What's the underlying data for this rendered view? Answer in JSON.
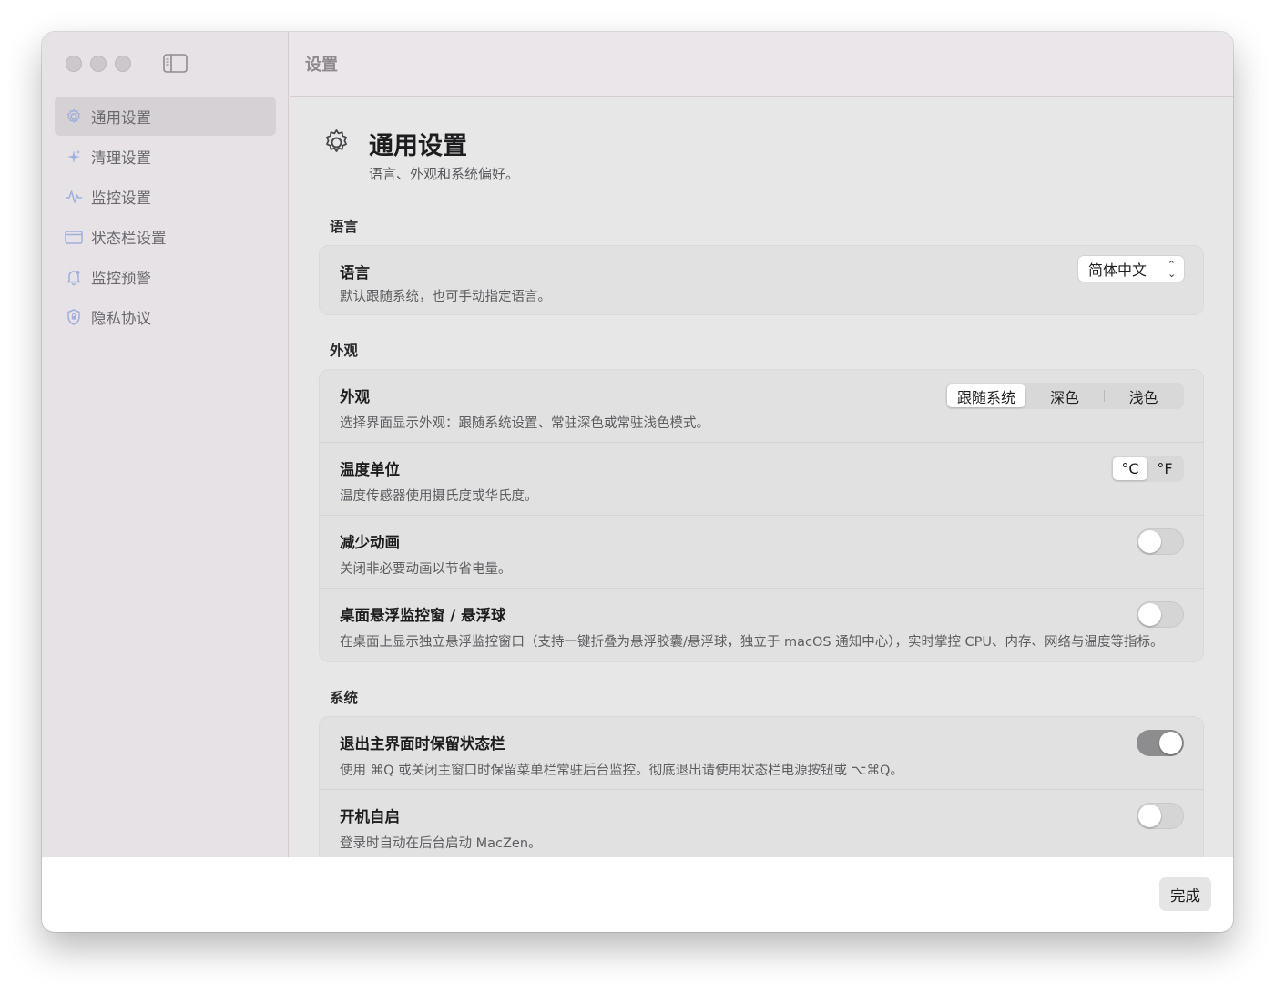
{
  "window": {
    "title": "设置"
  },
  "sidebar": {
    "items": [
      {
        "label": "通用设置",
        "icon": "gear-icon",
        "active": true
      },
      {
        "label": "清理设置",
        "icon": "sparkles-icon"
      },
      {
        "label": "监控设置",
        "icon": "waveform-icon"
      },
      {
        "label": "状态栏设置",
        "icon": "menubar-icon"
      },
      {
        "label": "监控预警",
        "icon": "bell-icon"
      },
      {
        "label": "隐私协议",
        "icon": "shield-icon"
      }
    ]
  },
  "page": {
    "title": "通用设置",
    "subtitle": "语言、外观和系统偏好。"
  },
  "sections": {
    "language": {
      "label": "语言",
      "rows": [
        {
          "title": "语言",
          "desc": "默认跟随系统，也可手动指定语言。",
          "value": "简体中文"
        }
      ]
    },
    "appearance": {
      "label": "外观",
      "rows": [
        {
          "title": "外观",
          "desc": "选择界面显示外观：跟随系统设置、常驻深色或常驻浅色模式。",
          "options": [
            "跟随系统",
            "深色",
            "浅色"
          ],
          "selected": "跟随系统"
        },
        {
          "title": "温度单位",
          "desc": "温度传感器使用摄氏度或华氏度。",
          "options": [
            "°C",
            "°F"
          ],
          "selected": "°C"
        },
        {
          "title": "减少动画",
          "desc": "关闭非必要动画以节省电量。",
          "on": false
        },
        {
          "title": "桌面悬浮监控窗 / 悬浮球",
          "desc": "在桌面上显示独立悬浮监控窗口（支持一键折叠为悬浮胶囊/悬浮球，独立于 macOS 通知中心），实时掌控 CPU、内存、网络与温度等指标。",
          "on": false
        }
      ]
    },
    "system": {
      "label": "系统",
      "rows": [
        {
          "title": "退出主界面时保留状态栏",
          "desc": "使用 ⌘Q 或关闭主窗口时保留菜单栏常驻后台监控。彻底退出请使用状态栏电源按钮或 ⌥⌘Q。",
          "on": true
        },
        {
          "title": "开机自启",
          "desc": "登录时自动在后台启动 MacZen。",
          "on": false
        }
      ]
    }
  },
  "footer": {
    "done_label": "完成"
  },
  "colors": {
    "accent_toggle_on": "#8d8d8f",
    "sidebar_icon": "#9fb0dc"
  }
}
